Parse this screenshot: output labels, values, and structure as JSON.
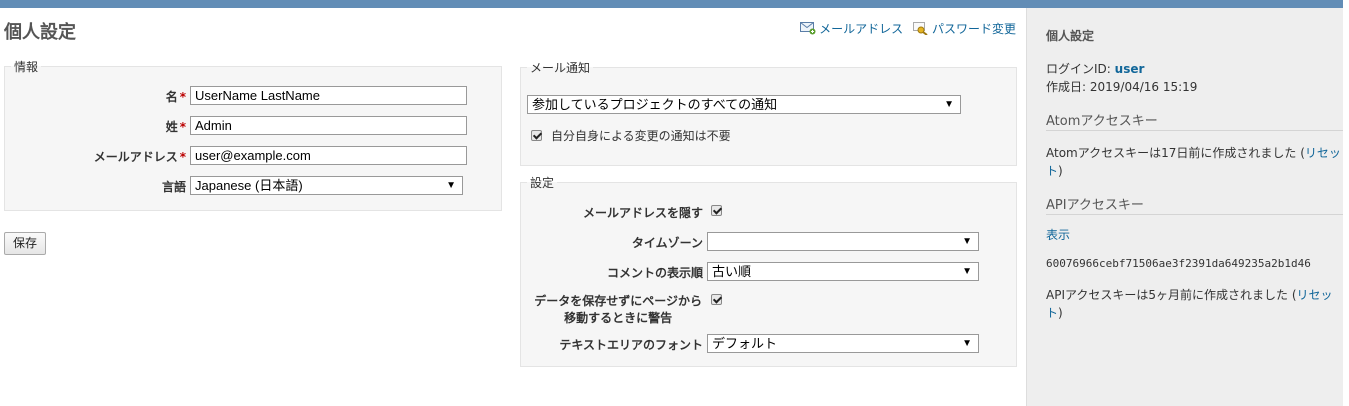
{
  "page": {
    "title": "個人設定"
  },
  "contextual": {
    "email_link": "メールアドレス",
    "password_link": "パスワード変更"
  },
  "info": {
    "legend": "情報",
    "firstname": {
      "label": "名",
      "value": "UserName LastName"
    },
    "lastname": {
      "label": "姓",
      "value": "Admin"
    },
    "mail": {
      "label": "メールアドレス",
      "value": "user@example.com"
    },
    "language": {
      "label": "言語",
      "value": "Japanese (日本語)"
    },
    "required_mark": "*"
  },
  "save_button": "保存",
  "mail_notification": {
    "legend": "メール通知",
    "option": "参加しているプロジェクトのすべての通知",
    "no_self_notified": {
      "label": "自分自身による変更の通知は不要",
      "checked": true
    }
  },
  "preferences": {
    "legend": "設定",
    "hide_mail": {
      "label": "メールアドレスを隠す",
      "checked": true
    },
    "time_zone": {
      "label": "タイムゾーン",
      "value": ""
    },
    "comments_sorting": {
      "label": "コメントの表示順",
      "value": "古い順"
    },
    "warn_unsaved_line1": "データを保存せずにページから",
    "warn_unsaved_line2": "移動するときに警告",
    "warn_unsaved_checked": true,
    "textarea_font": {
      "label": "テキストエリアのフォント",
      "value": "デフォルト"
    }
  },
  "sidebar": {
    "title": "個人設定",
    "login_label": "ログインID:",
    "login_value": "user",
    "created_on": "作成日: 2019/04/16 15:19",
    "atom_heading": "Atomアクセスキー",
    "atom_text_a": "Atomアクセスキーは17日前に作成されました (",
    "atom_reset_a": "リセッ",
    "atom_reset_b": "ト",
    "atom_text_b": ")",
    "api_heading": "APIアクセスキー",
    "api_show": "表示",
    "api_key": "60076966cebf71506ae3f2391da649235a2b1d46",
    "api_text_a": "APIアクセスキーは5ヶ月前に作成されました (",
    "api_reset_a": "リセッ",
    "api_reset_b": "ト",
    "api_text_b": ")"
  },
  "colors": {
    "header": "#628db6",
    "link": "#116699",
    "required": "#bb0000",
    "sidebar_bg": "#eeeeee"
  },
  "icons": [
    "email-icon",
    "key-icon",
    "dropdown-arrow-icon",
    "checkbox-checked-icon"
  ]
}
